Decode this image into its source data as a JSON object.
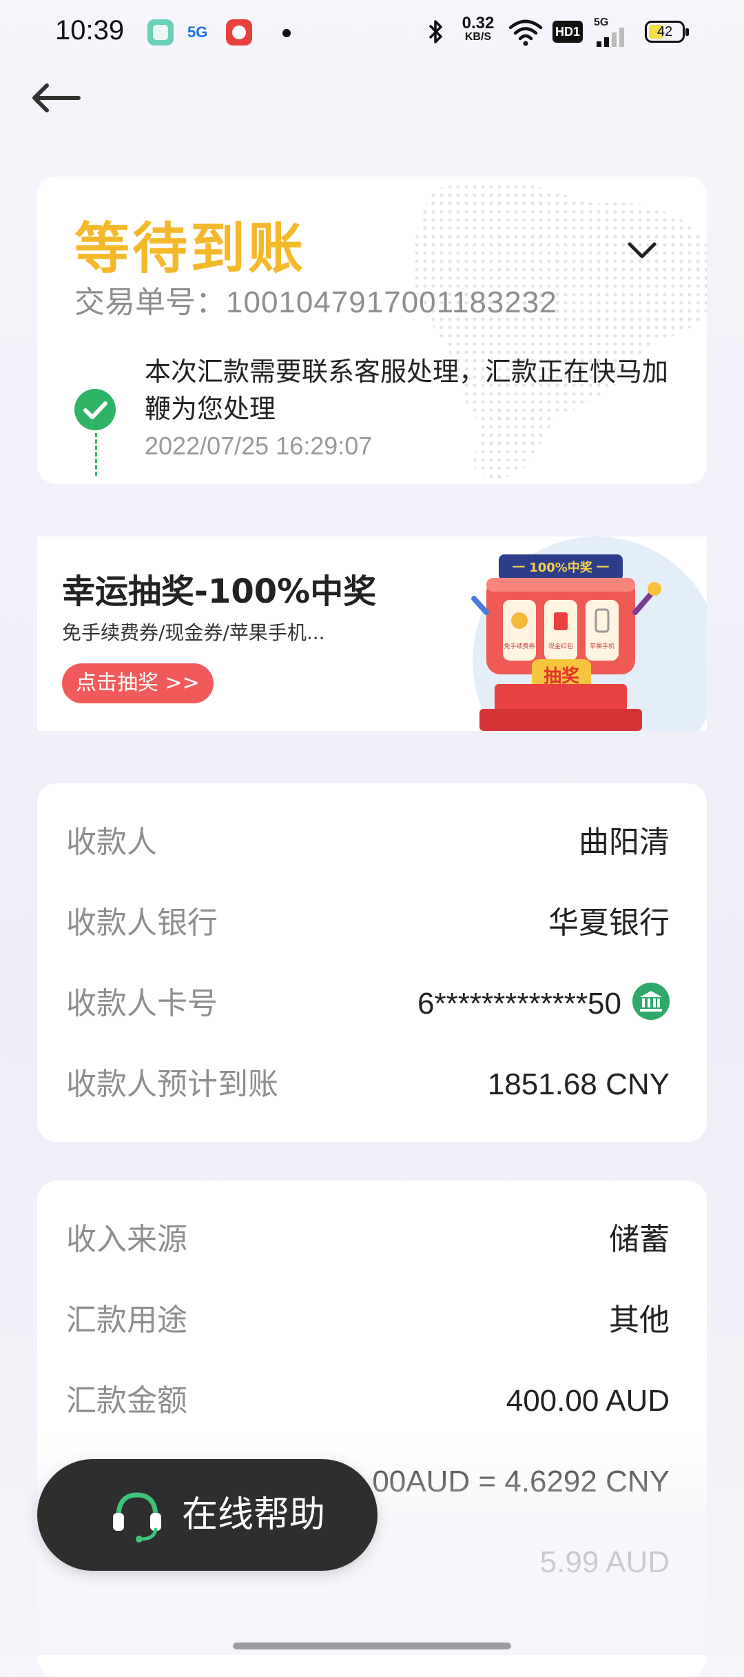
{
  "status_bar": {
    "time": "10:39",
    "net_5g_app": "5G",
    "speed_value": "0.32",
    "speed_unit": "KB/S",
    "hd_label": "HD1",
    "signal_label": "5G",
    "battery": "42",
    "icons": [
      "app-icon",
      "5g-app-icon",
      "app-icon",
      "bluetooth-icon",
      "wifi-icon",
      "signal-icon",
      "battery-icon"
    ]
  },
  "nav": {
    "back_icon": "arrow-left-icon"
  },
  "status_card": {
    "title": "等待到账",
    "txn_label": "交易单号：",
    "txn_number": "1001047917001183232",
    "message": "本次汇款需要联系客服处理，汇款正在快马加鞭为您处理",
    "timestamp": "2022/07/25 16:29:07",
    "accent_color": "#f4b92b",
    "check_color": "#2fb466"
  },
  "lottery": {
    "title": "幸运抽奖-100%中奖",
    "subtitle": "免手续费券/现金券/苹果手机...",
    "button_label": "点击抽奖 >>",
    "machine_banner": "一 100%中奖 一",
    "machine_button": "抽奖",
    "reels": [
      "免手续费券",
      "现金红包",
      "苹果手机"
    ]
  },
  "payee": {
    "rows": [
      {
        "label": "收款人",
        "value": "曲阳清"
      },
      {
        "label": "收款人银行",
        "value": "华夏银行"
      },
      {
        "label": "收款人卡号",
        "value": "6*************50"
      },
      {
        "label": "收款人预计到账",
        "value": "1851.68 CNY"
      }
    ]
  },
  "source": {
    "rows": [
      {
        "label": "收入来源",
        "value": "储蓄"
      },
      {
        "label": "汇款用途",
        "value": "其他"
      },
      {
        "label": "汇款金额",
        "value": "400.00 AUD"
      },
      {
        "label": "",
        "value": "00AUD = 4.6292 CNY"
      },
      {
        "label": "",
        "value": "5.99 AUD"
      }
    ]
  },
  "help": {
    "label": "在线帮助"
  }
}
